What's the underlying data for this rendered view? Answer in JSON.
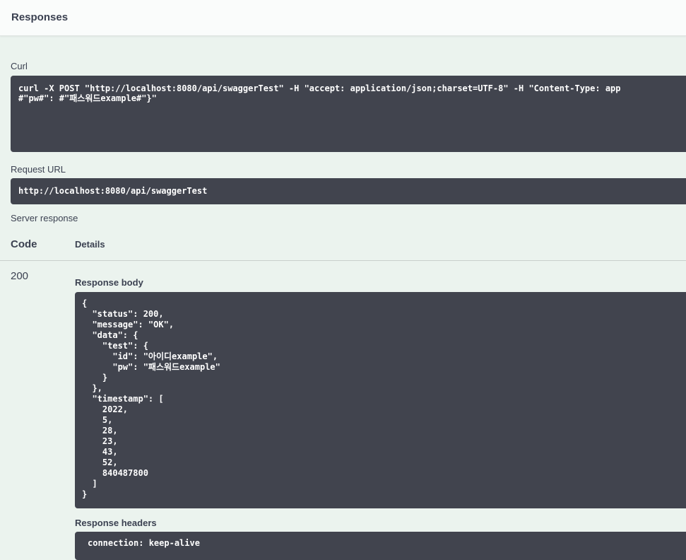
{
  "section": {
    "title": "Responses"
  },
  "curl": {
    "label": "Curl",
    "command": "curl -X POST \"http://localhost:8080/api/swaggerTest\" -H \"accept: application/json;charset=UTF-8\" -H \"Content-Type: app\n#\"pw#\": #\"패스워드example#\"}\""
  },
  "request_url": {
    "label": "Request URL",
    "value": "http://localhost:8080/api/swaggerTest"
  },
  "server_response": {
    "label": "Server response",
    "columns": {
      "code": "Code",
      "details": "Details"
    },
    "code": "200",
    "response_body_label": "Response body",
    "response_body": "{\n  \"status\": 200,\n  \"message\": \"OK\",\n  \"data\": {\n    \"test\": {\n      \"id\": \"아이디example\",\n      \"pw\": \"패스워드example\"\n    }\n  },\n  \"timestamp\": [\n    2022,\n    5,\n    28,\n    23,\n    43,\n    52,\n    840487800\n  ]\n}",
    "response_headers_label": "Response headers",
    "response_headers": "connection: keep-alive"
  }
}
